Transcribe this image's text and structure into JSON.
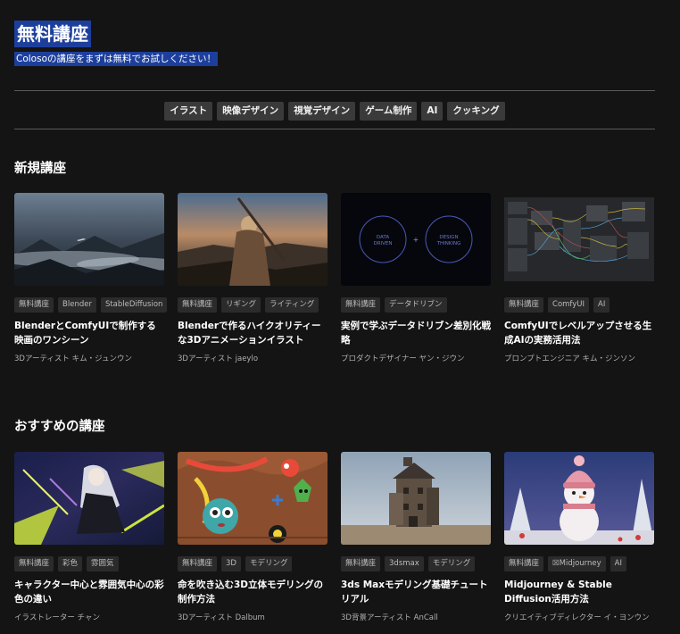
{
  "hero": {
    "title": "無料講座",
    "subtitle": "Colosoの講座をまずは無料でお試しください！"
  },
  "categories": [
    "イラスト",
    "映像デザイン",
    "視覚デザイン",
    "ゲーム制作",
    "AI",
    "クッキング"
  ],
  "sections": {
    "new": {
      "title": "新規講座",
      "courses": [
        {
          "tags": [
            "無料講座",
            "Blender",
            "StableDiffusion"
          ],
          "title": "BlenderとComfyUIで制作する映画のワンシーン",
          "author": "3Dアーティスト キム・ジュンウン",
          "thumb_icon": "misty-mountains-image"
        },
        {
          "tags": [
            "無料講座",
            "リギング",
            "ライティング"
          ],
          "title": "Blenderで作るハイクオリティーな3Dアニメーションイラスト",
          "author": "3Dアーティスト jaeylo",
          "thumb_icon": "warrior-sunset-image"
        },
        {
          "tags": [
            "無料講座",
            "データドリブン"
          ],
          "title": "実例で学ぶデータドリブン差別化戦略",
          "author": "プロダクトデザイナー ヤン・ジウン",
          "thumb_icon": "data-design-circles-image",
          "thumb_text": {
            "left_line1": "DATA",
            "left_line2": "DRIVEN",
            "plus": "+",
            "right_line1": "DESIGN",
            "right_line2": "THINKING"
          }
        },
        {
          "tags": [
            "無料講座",
            "ComfyUI",
            "AI"
          ],
          "title": "ComfyUIでレベルアップさせる生成AIの実務活用法",
          "author": "プロンプトエンジニア キム・ジンソン",
          "thumb_icon": "node-graph-image"
        }
      ]
    },
    "recommended": {
      "title": "おすすめの講座",
      "courses": [
        {
          "tags": [
            "無料講座",
            "彩色",
            "雰囲気"
          ],
          "title": "キャラクター中心と雰囲気中心の彩色の違い",
          "author": "イラストレーター チャン",
          "thumb_icon": "anime-character-image"
        },
        {
          "tags": [
            "無料講座",
            "3D",
            "モデリング"
          ],
          "title": "命を吹き込む3D立体モデリングの制作方法",
          "author": "3Dアーティスト Dalbum",
          "thumb_icon": "cute-monsters-image"
        },
        {
          "tags": [
            "無料講座",
            "3dsmax",
            "モデリング"
          ],
          "title": "3ds Maxモデリング基礎チュートリアル",
          "author": "3D背景アーティスト AnCall",
          "thumb_icon": "old-tower-house-image"
        },
        {
          "tags": [
            "無料講座",
            "☒Midjourney",
            "AI"
          ],
          "title": "Midjourney & Stable Diffusion活用方法",
          "author": "クリエイティブディレクター イ・ヨンウン",
          "thumb_icon": "snowman-image"
        }
      ]
    }
  },
  "colors": {
    "background": "#141414",
    "highlight": "#1d3f9c",
    "category_bg": "#3a3a3a",
    "tag_bg": "#2b2b2b"
  }
}
